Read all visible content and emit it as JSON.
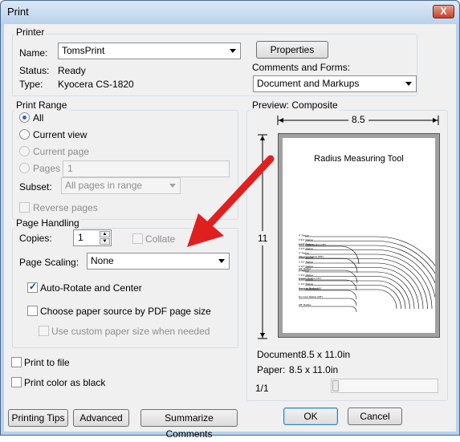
{
  "window": {
    "title": "Print",
    "close_glyph": "X"
  },
  "printer": {
    "group_label": "Printer",
    "name_label": "Name:",
    "name_value": "TomsPrint",
    "properties_button": "Properties",
    "status_label": "Status:",
    "status_value": "Ready",
    "type_label": "Type:",
    "type_value": "Kyocera CS-1820",
    "comments_label": "Comments and Forms:",
    "comments_value": "Document and Markups"
  },
  "print_range": {
    "group_label": "Print Range",
    "all": "All",
    "current_view": "Current view",
    "current_page": "Current page",
    "pages": "Pages",
    "pages_value": "1",
    "subset_label": "Subset:",
    "subset_value": "All pages in range",
    "reverse_pages": "Reverse pages"
  },
  "page_handling": {
    "group_label": "Page Handling",
    "copies_label": "Copies:",
    "copies_value": "1",
    "collate": "Collate",
    "scaling_label": "Page Scaling:",
    "scaling_value": "None",
    "auto_rotate": "Auto-Rotate and Center",
    "choose_source": "Choose paper source by PDF page size",
    "custom_size": "Use custom paper size when needed"
  },
  "options": {
    "print_to_file": "Print to file",
    "print_color_black": "Print color as black"
  },
  "preview": {
    "label": "Preview: Composite",
    "width_dim": "8.5",
    "height_dim": "11",
    "page_title": "Radius Measuring Tool",
    "radius_labels": [
      "4\" Radius",
      "3 3/4\" Radius",
      "3 1/2\" Radius",
      "3 1/4\" Radius",
      "3\" Radius",
      "2 3/4\" Radius",
      "2 1/2\" Radius",
      "2 1/4\" Radius",
      "2\" Radius",
      "1 3/4\" Radius",
      "1 1/2\" Radius",
      "1 1/4\" Radius",
      "One Inch Radius (1\")"
    ],
    "coin_labels": [
      "Silver Dollar Radius (7/8\")",
      "Fifty Cent Radius (5/8\")",
      "3/4\" Radius",
      "Quarter Radius (1/2\")",
      "Nickel Radius (1/2\")",
      "Ten Cent Radius (3/8\")",
      "3/8\" Radius"
    ],
    "document_label": "Document:",
    "document_value": "8.5 x 11.0in",
    "paper_label": "Paper:",
    "paper_value": "8.5 x 11.0in",
    "page_counter": "1/1"
  },
  "buttons": {
    "printing_tips": "Printing Tips",
    "advanced": "Advanced",
    "summarize": "Summarize Comments",
    "ok": "OK",
    "cancel": "Cancel"
  },
  "colors": {
    "arrow": "#e02020",
    "titlebar": "#bcd3ec",
    "dialog_bg": "#f0f0f0"
  }
}
